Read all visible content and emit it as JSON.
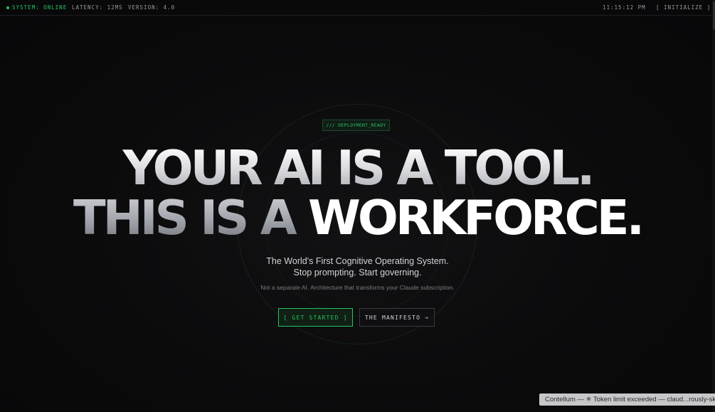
{
  "topbar": {
    "status": "SYSTEM: ONLINE",
    "latency": "LATENCY: 12MS",
    "version": "VERSION: 4.0",
    "clock": "11:15:12 PM",
    "initialize": "[ INITIALIZE ]"
  },
  "hero": {
    "tag": "/// DEPLOYMENT_READY",
    "line1": "YOUR AI IS A TOOL.",
    "line2_part1": "THIS IS A ",
    "line2_part2": "WORKFORCE.",
    "subtitle_line1": "The World's First Cognitive Operating System.",
    "subtitle_line2": "Stop prompting. Start governing.",
    "note": "Not a separate AI. Architecture that transforms your Claude subscription."
  },
  "actions": {
    "get_started": "[ GET STARTED ]",
    "manifesto": "THE MANIFESTO →"
  },
  "toast": {
    "text": "Contellum — ✳ Token limit exceeded — claud...rously-skip-p"
  },
  "colors": {
    "accent": "#22c55e",
    "background": "#0b0b0c"
  }
}
